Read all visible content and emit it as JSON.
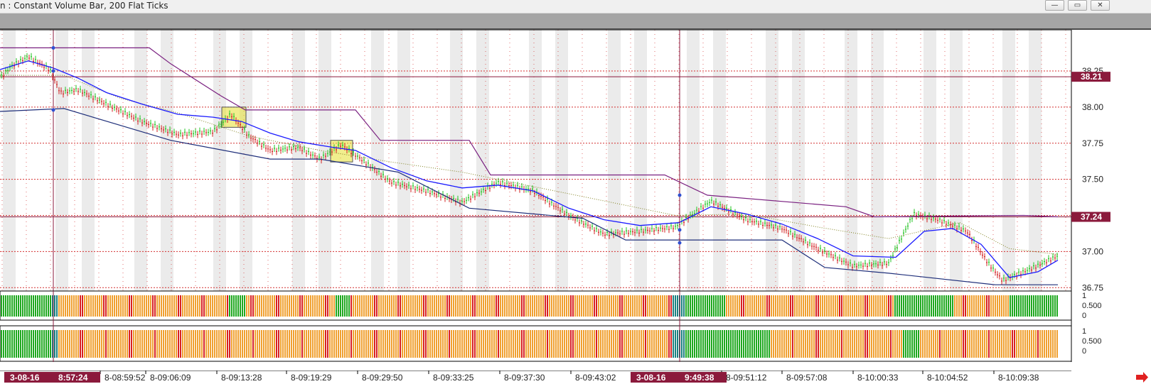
{
  "window": {
    "title": "n : Constant Volume Bar, 200 Flat Ticks",
    "minimize_glyph": "—",
    "maximize_glyph": "▭",
    "close_glyph": "✕"
  },
  "colors": {
    "up_bar": "#22c322",
    "down_bar": "#d22222",
    "ema": "#1a1aff",
    "trail": "#7a2080",
    "support": "#1f2f7a",
    "dotted": "#808020",
    "grid": "#d43030",
    "highlight": "#e6e030",
    "price_badge": "#8b1a3c",
    "histo_orange": "#f0a030",
    "histo_red": "#d82020",
    "histo_green": "#1fa81f",
    "histo_teal": "#1a8080"
  },
  "price_axis": {
    "ticks": [
      "38.25",
      "38.00",
      "37.75",
      "37.50",
      "37.25",
      "37.00",
      "36.75"
    ],
    "badges": [
      "38.21",
      "37.24"
    ]
  },
  "panel1_axis": [
    "1",
    "0.500",
    "0"
  ],
  "panel2_axis": [
    "1",
    "0.500",
    "0"
  ],
  "time_axis": {
    "labels": [
      "8-08:59:52",
      "8-09:06:09",
      "8-09:13:28",
      "8-09:19:29",
      "8-09:29:50",
      "8-09:33:25",
      "8-09:37:30",
      "8-09:43:02",
      "8-09:51:12",
      "8-09:57:08",
      "8-10:00:33",
      "8-10:04:52",
      "8-10:09:38"
    ],
    "cursor1_date": "3-08-16",
    "cursor1_time": "8:57:24",
    "cursor2_date": "3-08-16",
    "cursor2_time": "9:49:38"
  },
  "icons": [
    "scroll-right-arrow-icon",
    "minimize-icon",
    "maximize-icon",
    "close-icon"
  ],
  "chart_data": {
    "type": "bar",
    "price_range": [
      36.72,
      38.32
    ],
    "ema": [
      [
        0,
        38.26
      ],
      [
        40,
        38.32
      ],
      [
        75,
        38.27
      ],
      [
        110,
        38.2
      ],
      [
        150,
        38.1
      ],
      [
        200,
        38.02
      ],
      [
        250,
        37.95
      ],
      [
        300,
        37.93
      ],
      [
        340,
        37.9
      ],
      [
        380,
        37.82
      ],
      [
        420,
        37.76
      ],
      [
        470,
        37.72
      ],
      [
        500,
        37.7
      ],
      [
        550,
        37.58
      ],
      [
        600,
        37.49
      ],
      [
        650,
        37.44
      ],
      [
        700,
        37.46
      ],
      [
        750,
        37.42
      ],
      [
        800,
        37.3
      ],
      [
        850,
        37.22
      ],
      [
        900,
        37.18
      ],
      [
        955,
        37.2
      ],
      [
        1000,
        37.31
      ],
      [
        1050,
        37.26
      ],
      [
        1100,
        37.19
      ],
      [
        1150,
        37.09
      ],
      [
        1200,
        36.97
      ],
      [
        1260,
        36.96
      ],
      [
        1300,
        37.14
      ],
      [
        1340,
        37.16
      ],
      [
        1380,
        37.05
      ],
      [
        1420,
        36.82
      ],
      [
        1460,
        36.86
      ],
      [
        1488,
        36.94
      ]
    ],
    "trail_line": [
      [
        0,
        38.41
      ],
      [
        210,
        38.41
      ],
      [
        240,
        38.3
      ],
      [
        310,
        38.08
      ],
      [
        345,
        37.98
      ],
      [
        500,
        37.98
      ],
      [
        535,
        37.77
      ],
      [
        660,
        37.77
      ],
      [
        690,
        37.53
      ],
      [
        935,
        37.53
      ],
      [
        995,
        37.39
      ],
      [
        1190,
        37.31
      ],
      [
        1230,
        37.24
      ],
      [
        1440,
        37.25
      ],
      [
        1488,
        37.24
      ]
    ],
    "support_line": [
      [
        0,
        37.97
      ],
      [
        90,
        37.99
      ],
      [
        240,
        37.77
      ],
      [
        380,
        37.64
      ],
      [
        450,
        37.64
      ],
      [
        560,
        37.55
      ],
      [
        660,
        37.3
      ],
      [
        820,
        37.23
      ],
      [
        880,
        37.08
      ],
      [
        960,
        37.08
      ],
      [
        1100,
        37.08
      ],
      [
        1160,
        36.89
      ],
      [
        1250,
        36.85
      ],
      [
        1400,
        36.77
      ],
      [
        1488,
        36.77
      ]
    ],
    "dotted_line": [
      [
        0,
        38.22
      ],
      [
        90,
        38.22
      ],
      [
        170,
        38.06
      ],
      [
        250,
        37.96
      ],
      [
        350,
        37.8
      ],
      [
        450,
        37.7
      ],
      [
        550,
        37.62
      ],
      [
        650,
        37.55
      ],
      [
        750,
        37.45
      ],
      [
        850,
        37.35
      ],
      [
        950,
        37.25
      ],
      [
        1050,
        37.26
      ],
      [
        1150,
        37.17
      ],
      [
        1250,
        37.09
      ],
      [
        1350,
        37.2
      ],
      [
        1420,
        37.02
      ],
      [
        1488,
        36.98
      ]
    ],
    "close_path": [
      [
        0,
        38.2
      ],
      [
        15,
        38.28
      ],
      [
        40,
        38.35
      ],
      [
        70,
        38.26
      ],
      [
        85,
        38.1
      ],
      [
        110,
        38.12
      ],
      [
        150,
        38.02
      ],
      [
        200,
        37.9
      ],
      [
        250,
        37.81
      ],
      [
        300,
        37.83
      ],
      [
        325,
        37.95
      ],
      [
        350,
        37.8
      ],
      [
        380,
        37.7
      ],
      [
        420,
        37.72
      ],
      [
        450,
        37.64
      ],
      [
        480,
        37.74
      ],
      [
        505,
        37.65
      ],
      [
        550,
        37.48
      ],
      [
        600,
        37.42
      ],
      [
        650,
        37.34
      ],
      [
        700,
        37.48
      ],
      [
        750,
        37.42
      ],
      [
        800,
        37.25
      ],
      [
        850,
        37.12
      ],
      [
        900,
        37.14
      ],
      [
        950,
        37.17
      ],
      [
        1000,
        37.35
      ],
      [
        1050,
        37.22
      ],
      [
        1100,
        37.16
      ],
      [
        1150,
        37.02
      ],
      [
        1200,
        36.9
      ],
      [
        1250,
        36.92
      ],
      [
        1285,
        37.26
      ],
      [
        1320,
        37.22
      ],
      [
        1360,
        37.14
      ],
      [
        1390,
        36.92
      ],
      [
        1410,
        36.8
      ],
      [
        1450,
        36.88
      ],
      [
        1488,
        36.97
      ]
    ],
    "highlight_boxes": [
      [
        312,
        38.0,
        346,
        37.86
      ],
      [
        465,
        37.77,
        496,
        37.62
      ]
    ]
  }
}
